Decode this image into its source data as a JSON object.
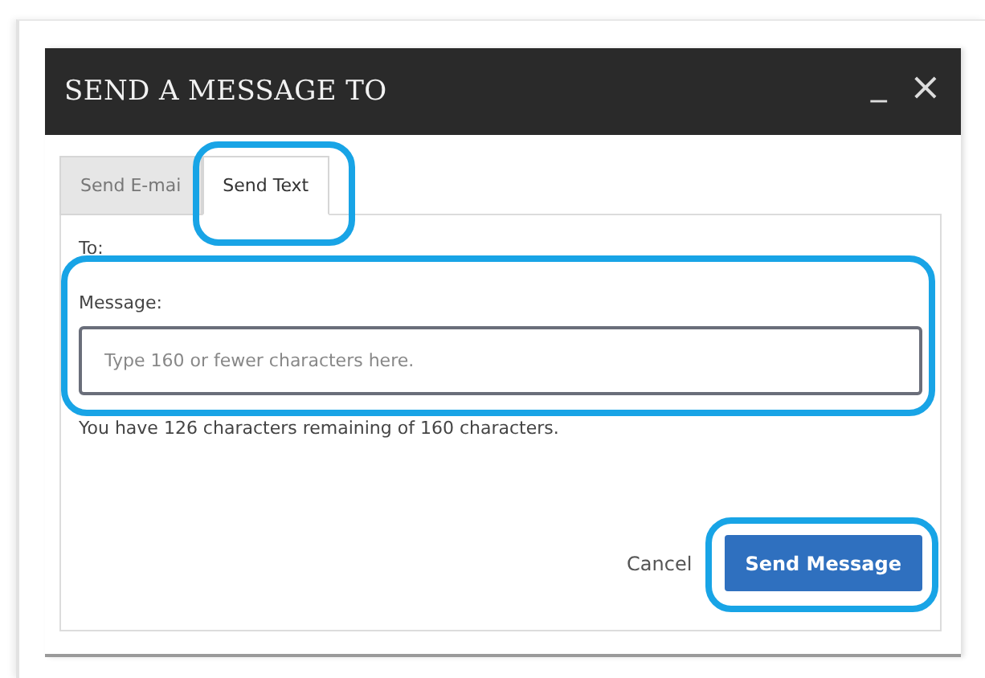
{
  "dialog": {
    "title": "SEND A MESSAGE TO",
    "controls": [
      {
        "kind": "minimize",
        "label": "_"
      },
      {
        "kind": "close",
        "label": "×"
      }
    ]
  },
  "tabs": [
    {
      "label": "Send E-mai",
      "selected": false,
      "highlighted": false
    },
    {
      "label": "Send Text",
      "selected": true,
      "highlighted": true
    }
  ],
  "form": {
    "to_label": "To:",
    "message_label": "Message:",
    "message_placeholder": "Type 160 or fewer characters here.",
    "message_highlighted": true,
    "remaining": "You have 126 characters remaining of 160 characters."
  },
  "buttons": [
    {
      "kind": "link",
      "label": "Cancel",
      "highlighted": false
    },
    {
      "kind": "primary",
      "label": "Send Message",
      "highlighted": true
    }
  ]
}
